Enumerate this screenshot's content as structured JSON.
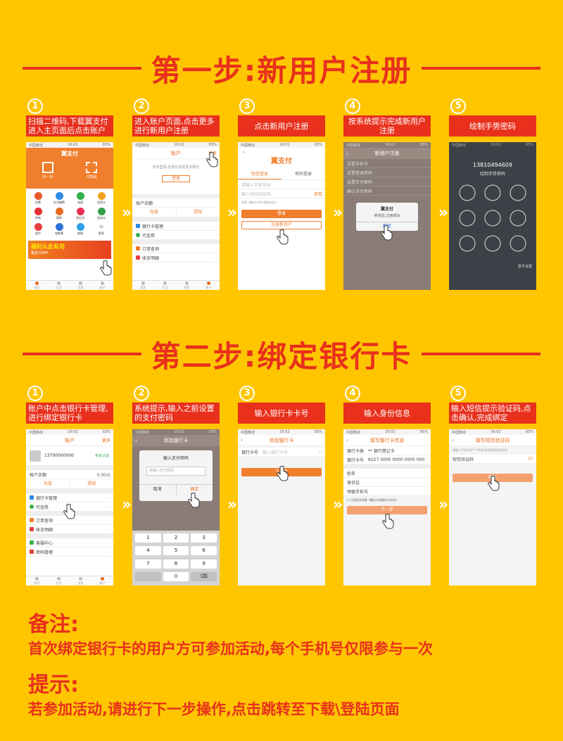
{
  "step1": {
    "title": "第一步:新用户注册",
    "items": [
      {
        "num": "1",
        "caption": "扫描二维码,下载翼支付进入主页面后点击账户"
      },
      {
        "num": "2",
        "caption": "进入账户页面,点击更多进行新用户注册"
      },
      {
        "num": "3",
        "caption": "点击新用户注册"
      },
      {
        "num": "4",
        "caption": "按系统提示完成新用户注册"
      },
      {
        "num": "5",
        "caption": "绘制手势密码"
      }
    ]
  },
  "step2": {
    "title": "第二步:绑定银行卡",
    "items": [
      {
        "num": "1",
        "caption": "账户中点击银行卡管理,进行绑定银行卡"
      },
      {
        "num": "2",
        "caption": "系统提示,输入之前设置的支付密码"
      },
      {
        "num": "3",
        "caption": "输入银行卡卡号"
      },
      {
        "num": "4",
        "caption": "输入身份信息"
      },
      {
        "num": "5",
        "caption": "输入短信提示验证码,点击确认,完成绑定"
      }
    ]
  },
  "arrow": "»",
  "notes": {
    "remark_heading": "备注:",
    "remark_text": "首次绑定银行卡的用户方可参加活动,每个手机号仅限参与一次",
    "tip_heading": "提示:",
    "tip_text": "若参加活动,请进行下一步操作,点击跳转至下载\\登陆页面"
  },
  "phones": {
    "status_carrier": "中国移动",
    "status_time": "16:02",
    "status_battery": "83%",
    "p1": {
      "brand": "翼支付",
      "top_actions": [
        "扫一扫",
        "付款码"
      ],
      "grid": [
        "话费",
        "生活缴费",
        "充值",
        "信用卡",
        "转账",
        "理财",
        "发红包",
        "加油卡",
        "医疗",
        "电影票",
        "商城",
        "更多"
      ],
      "banner": "福利从此有用",
      "banner_sub": "翼支付APP",
      "tabs": [
        "首页",
        "生活",
        "应用",
        "账户"
      ]
    },
    "p2": {
      "title": "账户",
      "more": "更多",
      "hint": "暂未登录,登录后享受更多服务",
      "login": "登录",
      "balance": "账户余额",
      "recharge": "充值",
      "withdraw": "提现",
      "menu": [
        "银行卡管理",
        "代金券",
        "订单查询",
        "收支明细"
      ],
      "tabs": [
        "首页",
        "生活",
        "应用",
        "账户"
      ]
    },
    "p3": {
      "brand": "翼支付",
      "tab_a": "短信登录",
      "tab_b": "密码登录",
      "phone_ph": "请输入手机号码",
      "code_ph": "输入短信验证码",
      "get_code": "获取",
      "agree": "同意《翼支付用户服务协议》",
      "login": "登录",
      "register": "注册新用户"
    },
    "p4": {
      "title": "新用户注册",
      "fields": [
        "设置手机号",
        "设置登录密码",
        "设置支付密码",
        "确认支付密码"
      ],
      "dialog_title": "翼支付",
      "dialog_msg": "恭喜您,注册成功",
      "dialog_ok": "确定"
    },
    "p5": {
      "phone": "13810494609",
      "hint": "绘制手势密码",
      "skip": "暂不设置"
    },
    "q1": {
      "title": "账户",
      "more": "更多",
      "phone": "13700000000",
      "verify": "实名认证",
      "balance": "账户余额",
      "balance_val": "0.00元",
      "recharge": "充值",
      "withdraw": "提现",
      "menu": [
        "银行卡管理",
        "代金券",
        "订单查询",
        "收支明细",
        "客服中心",
        "密码管理"
      ],
      "tabs": [
        "首页",
        "生活",
        "应用",
        "账户"
      ]
    },
    "q2": {
      "title": "添加银行卡",
      "dialog_title": "输入支付密码",
      "placeholder": "请输入支付密码",
      "cancel": "取消",
      "ok": "确定",
      "keys": [
        "1",
        "2",
        "3",
        "4",
        "5",
        "6",
        "7",
        "8",
        "9",
        "",
        "0",
        "⌫"
      ]
    },
    "q3": {
      "title": "添加银行卡",
      "label": "银行卡号",
      "placeholder": "输入银行卡号",
      "next": "下一步"
    },
    "q4": {
      "title": "填写银行卡信息",
      "card_type_label": "银行卡类",
      "card_type": "** 银行借记卡",
      "card_no_label": "银行卡号",
      "card_no": "6227 0000 0000 0000 000",
      "fields": [
        "姓名",
        "身份证",
        "预留手机号"
      ],
      "agree": "已阅读并同意《翼支付快捷支付协议》",
      "next": "下一步"
    },
    "q5": {
      "title": "填写短信验证码",
      "hint": "请输入手机138****0000收到的短信验证码",
      "label": "短信验证码",
      "resend": "57",
      "ok": "确认"
    }
  },
  "colors": {
    "background": "#ffc600",
    "accent": "#e8301c",
    "orange": "#f07e2c"
  }
}
